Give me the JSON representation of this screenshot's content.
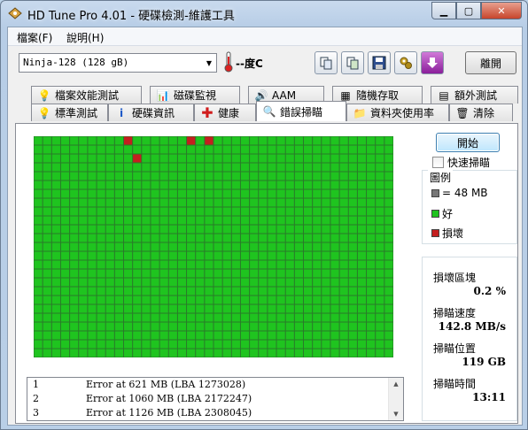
{
  "window": {
    "title": "HD Tune Pro 4.01 - 硬碟檢測-維護工具"
  },
  "menu": {
    "file": "檔案(F)",
    "help": "說明(H)"
  },
  "toolbar": {
    "drive": "Ninja-128 (128 gB)",
    "temperature": "--度C",
    "exit_label": "離開"
  },
  "tabs_top": [
    "檔案效能測試",
    "磁碟監視",
    "AAM",
    "隨機存取",
    "額外測試"
  ],
  "tabs_bottom": [
    "標準測試",
    "硬碟資訊",
    "健康",
    "錯誤掃瞄",
    "資料夾使用率",
    "清除"
  ],
  "scan": {
    "start_label": "開始",
    "quick_scan_label": "快速掃瞄",
    "legend_title": "圖例",
    "legend_block": "= 48 MB",
    "legend_good": "好",
    "legend_bad": "損壞",
    "grid_cols": 40,
    "grid_rows": 25,
    "bad_blocks": [
      [
        0,
        10
      ],
      [
        0,
        17
      ],
      [
        0,
        19
      ],
      [
        2,
        11
      ]
    ],
    "colors": {
      "good": "#1fc41f",
      "bad": "#c41f1f",
      "block": "#777777"
    }
  },
  "stats": {
    "damaged_label": "損壞區塊",
    "damaged_value": "0.2 %",
    "speed_label": "掃瞄速度",
    "speed_value": "142.8 MB/s",
    "position_label": "掃瞄位置",
    "position_value": "119 GB",
    "time_label": "掃瞄時間",
    "time_value": "13:11"
  },
  "errors": [
    {
      "n": "1",
      "text": "Error at 621 MB (LBA 1273028)"
    },
    {
      "n": "2",
      "text": "Error at 1060 MB (LBA 2172247)"
    },
    {
      "n": "3",
      "text": "Error at 1126 MB (LBA 2308045)"
    }
  ]
}
